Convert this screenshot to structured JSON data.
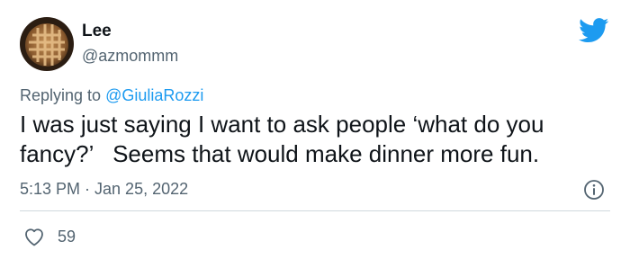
{
  "user": {
    "display_name": "Lee",
    "handle": "@azmommm"
  },
  "reply": {
    "prefix": "Replying to ",
    "mention": "@GiuliaRozzi"
  },
  "tweet": {
    "text": "I was just saying I want to ask people ‘what do you fancy?’   Seems that would make dinner more fun.",
    "timestamp": "5:13 PM · Jan 25, 2022"
  },
  "stats": {
    "likes": "59"
  },
  "colors": {
    "brand": "#1d9bf0",
    "secondary_text": "#536471",
    "divider": "#cfd9de"
  },
  "icons": {
    "brand": "twitter-bird-icon",
    "info": "info-icon",
    "like": "heart-icon"
  }
}
